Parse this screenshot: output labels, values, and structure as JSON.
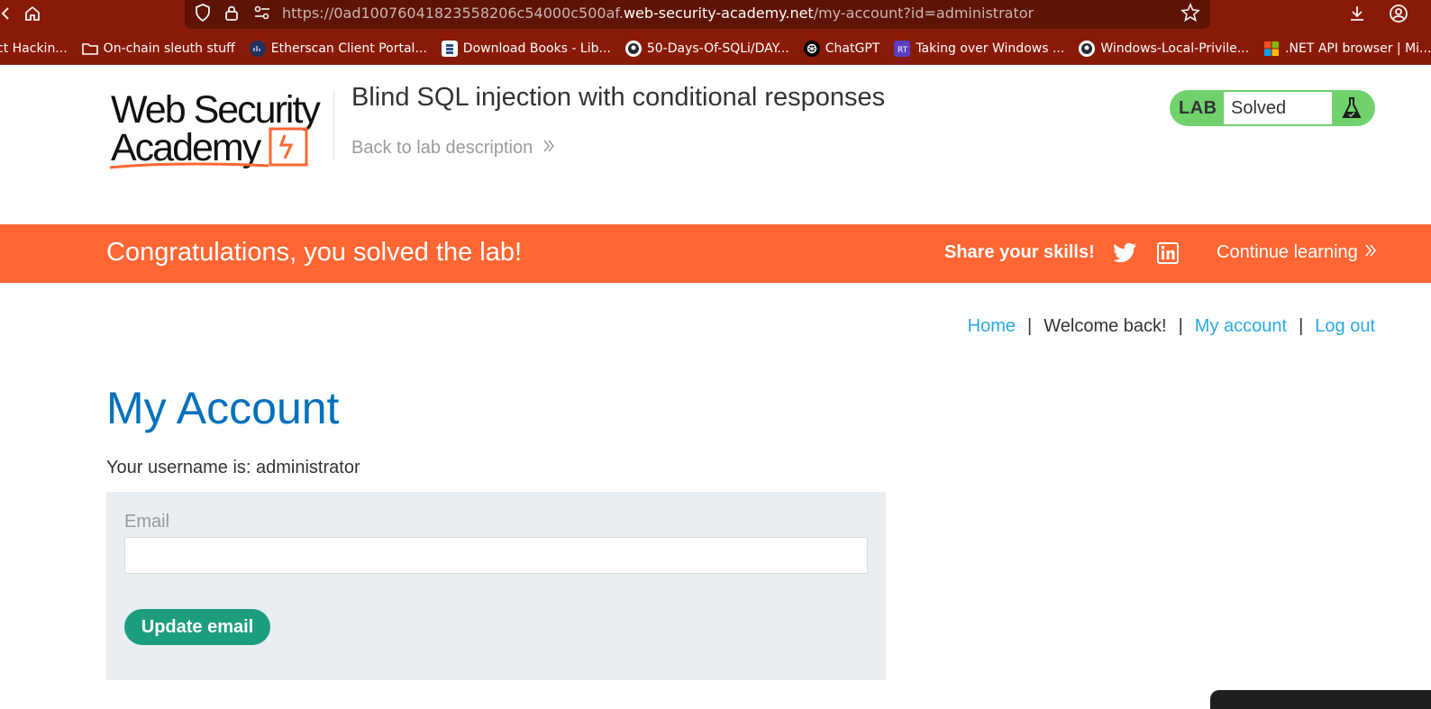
{
  "browser": {
    "url_prefix": "https://0ad10076041823558206c54000c500af.",
    "url_host": "web-security-academy.net",
    "url_path": "/my-account?id=administrator",
    "bookmarks": [
      {
        "label": "ct Hackin...",
        "icon": "folder-icon"
      },
      {
        "label": "On-chain sleuth stuff",
        "icon": "folder-icon"
      },
      {
        "label": "Etherscan Client Portal...",
        "icon": "etherscan-icon"
      },
      {
        "label": "Download Books - Lib...",
        "icon": "library-icon"
      },
      {
        "label": "50-Days-Of-SQLi/DAY...",
        "icon": "github-icon"
      },
      {
        "label": "ChatGPT",
        "icon": "chatgpt-icon"
      },
      {
        "label": "Taking over Windows ...",
        "icon": "rt-icon"
      },
      {
        "label": "Windows-Local-Privile...",
        "icon": "github-icon"
      },
      {
        "label": ".NET API browser | Mi...",
        "icon": "microsoft-icon"
      }
    ]
  },
  "header": {
    "logo_line1": "Web Security",
    "logo_line2": "Academy",
    "lab_title": "Blind SQL injection with conditional responses",
    "back_link": "Back to lab description",
    "lab_label": "LAB",
    "lab_status": "Solved",
    "colors": {
      "badge": "#70d16d",
      "accent": "#ff6633"
    }
  },
  "banner": {
    "message": "Congratulations, you solved the lab!",
    "share": "Share your skills!",
    "continue": "Continue learning"
  },
  "nav": {
    "home": "Home",
    "welcome": "Welcome back!",
    "my_account": "My account",
    "logout": "Log out",
    "separator": "|"
  },
  "main": {
    "title": "My Account",
    "username_line": "Your username is: administrator",
    "email_label": "Email",
    "email_value": "",
    "update_button": "Update email"
  }
}
